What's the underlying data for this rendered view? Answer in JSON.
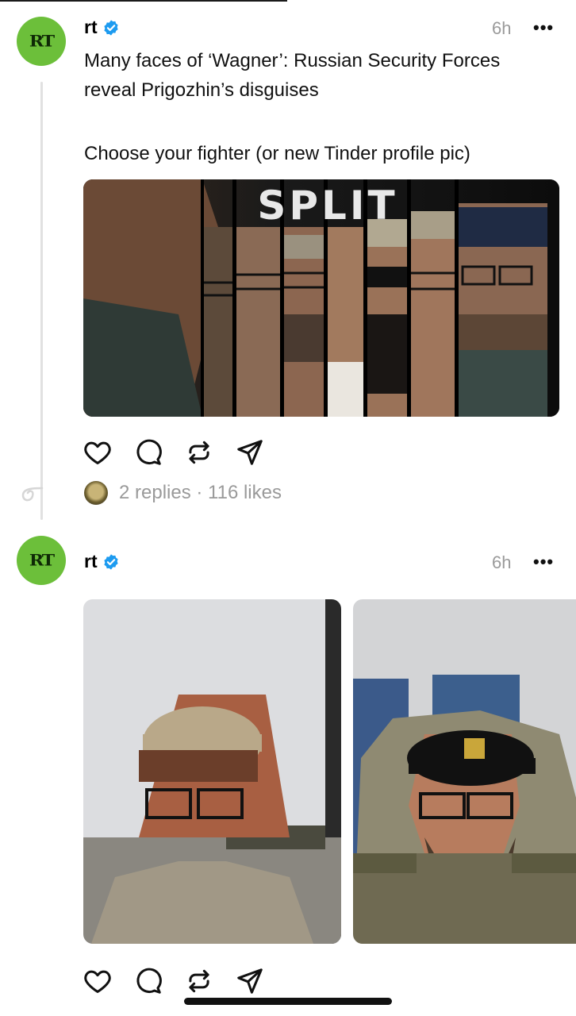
{
  "posts": [
    {
      "avatar_text": "RT",
      "username": "rt",
      "time": "6h",
      "more": "•••",
      "text_line1": "Many faces of ‘Wagner’: Russian Security Forces",
      "text_line2": "reveal Prigozhin’s disguises",
      "text_line3": "Choose your fighter (or new Tinder profile pic)",
      "image_title": "SPLIT",
      "replies_likes": "2 replies · 116 likes"
    },
    {
      "avatar_text": "RT",
      "username": "rt",
      "time": "6h",
      "more": "•••"
    }
  ],
  "icons": [
    "heart-icon",
    "comment-icon",
    "repost-icon",
    "share-icon",
    "verified-icon",
    "more-icon",
    "thread-loop-icon"
  ],
  "colors": {
    "avatar_green": "#6cbf3a",
    "verified_blue": "#1d9bf0",
    "muted_text": "#9a9a9a"
  }
}
